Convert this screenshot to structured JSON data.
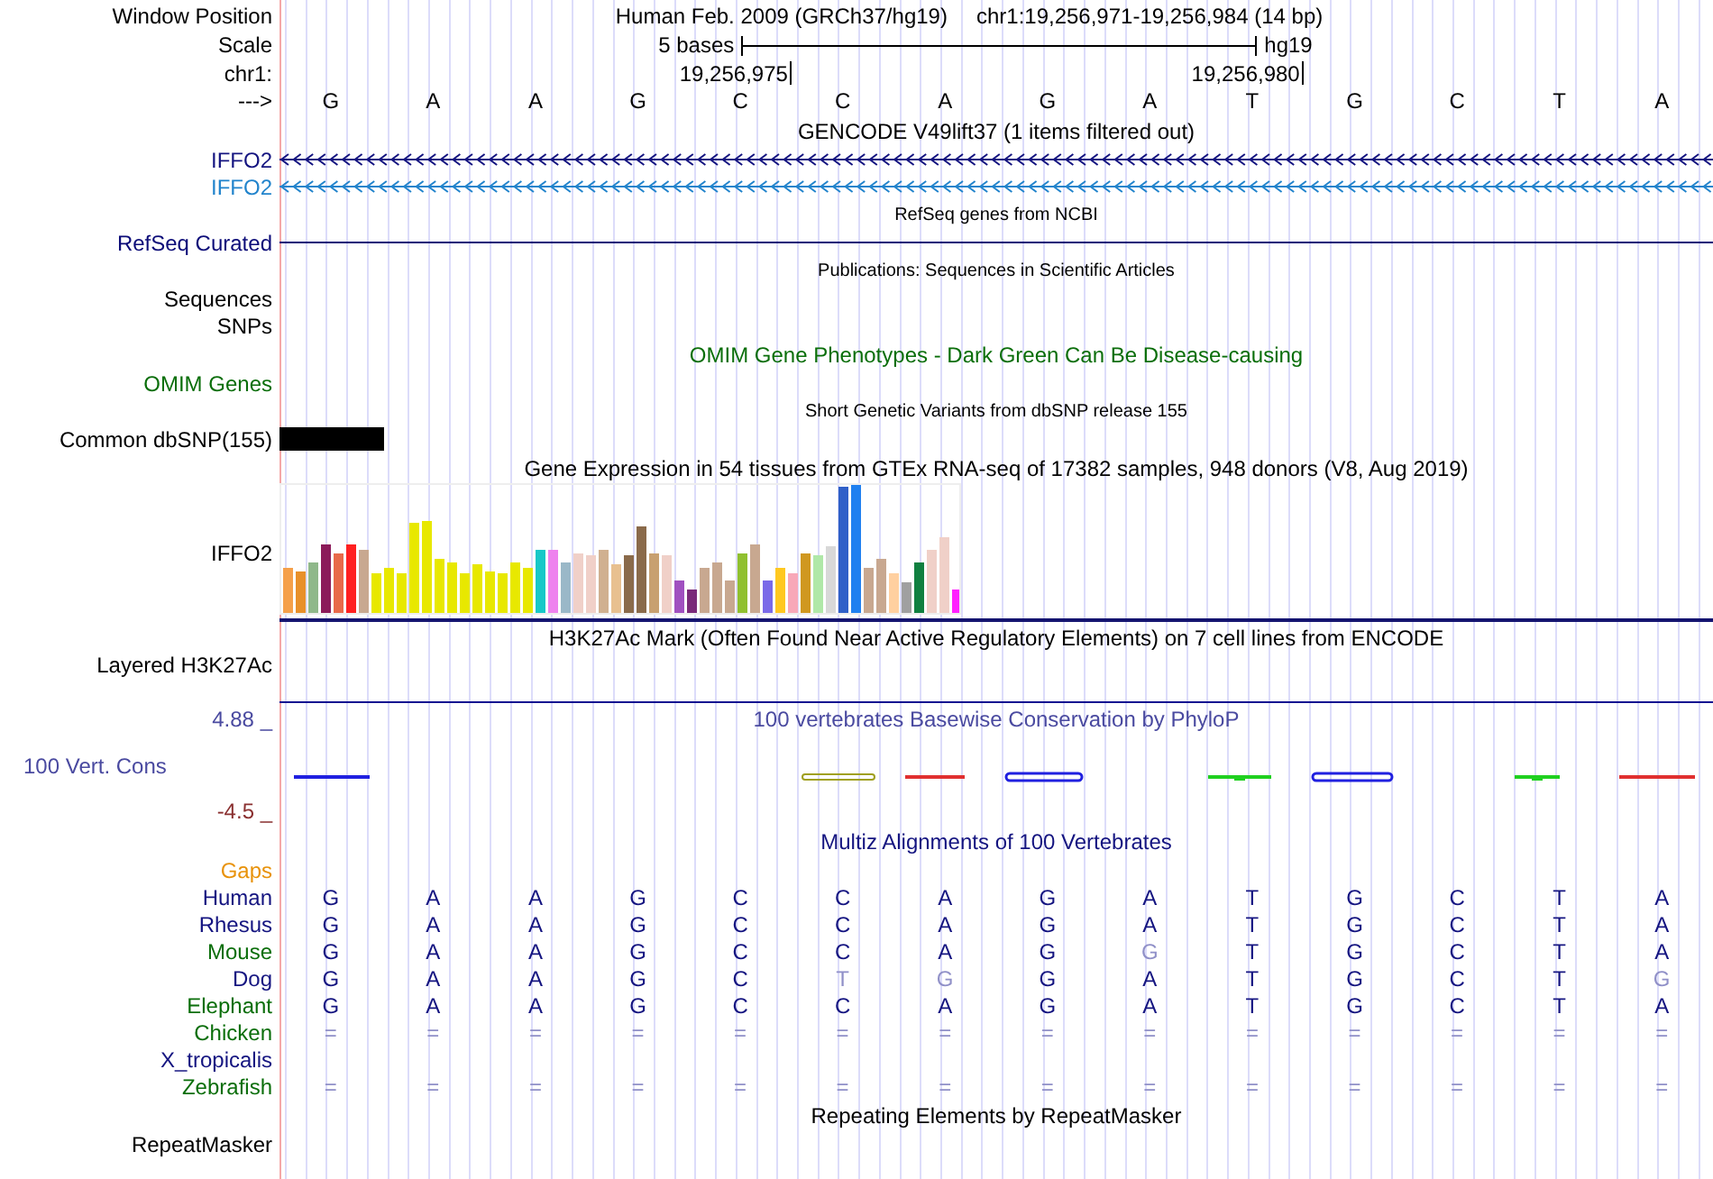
{
  "rows": [
    {
      "kind": "position",
      "label": "Window Position",
      "assembly": "Human Feb. 2009 (GRCh37/hg19)",
      "range": "chr1:19,256,971-19,256,984 (14 bp)"
    },
    {
      "kind": "scale",
      "label": "Scale",
      "length": "5 bases",
      "assembly": "hg19"
    },
    {
      "kind": "ruler",
      "label": "chr1:",
      "ticks": [
        "19,256,975",
        "19,256,980"
      ]
    },
    {
      "kind": "bases",
      "label": "--->",
      "bases": [
        "G",
        "A",
        "A",
        "G",
        "C",
        "C",
        "A",
        "G",
        "A",
        "T",
        "G",
        "C",
        "T",
        "A"
      ]
    },
    {
      "kind": "title",
      "text": "GENCODE V49lift37 (1 items filtered out)"
    },
    {
      "kind": "gene",
      "label": "IFFO2",
      "color": "#141480"
    },
    {
      "kind": "gene",
      "label": "IFFO2",
      "color": "#2284cc"
    },
    {
      "kind": "subtitle",
      "text": "RefSeq genes from NCBI"
    },
    {
      "kind": "line",
      "label": "RefSeq Curated",
      "color": "#0c0c78"
    },
    {
      "kind": "subtitle",
      "text": "Publications: Sequences in Scientific Articles"
    },
    {
      "kind": "label",
      "label": "Sequences"
    },
    {
      "kind": "label",
      "label": "SNPs"
    },
    {
      "kind": "title",
      "text": "OMIM Gene Phenotypes - Dark Green Can Be Disease-causing",
      "color": "#0a6e0a"
    },
    {
      "kind": "label",
      "label": "OMIM Genes",
      "color": "#0a6e0a"
    },
    {
      "kind": "subtitle",
      "text": "Short Genetic Variants from dbSNP release 155"
    },
    {
      "kind": "variant",
      "label": "Common dbSNP(155)"
    },
    {
      "kind": "title",
      "text": "Gene Expression in 54 tissues from GTEx RNA-seq of 17382 samples, 948 donors (V8, Aug 2019)"
    },
    {
      "kind": "expression",
      "label": "IFFO2"
    },
    {
      "kind": "title",
      "text": "H3K27Ac Mark (Often Found Near Active Regulatory Elements) on 7 cell lines from ENCODE"
    },
    {
      "kind": "signal",
      "label": "Layered H3K27Ac"
    },
    {
      "kind": "conservation",
      "title": "100 vertebrates Basewise Conservation by PhyloP",
      "label": "100 Vert. Cons",
      "max": "4.88 _",
      "min": "-4.5 _"
    },
    {
      "kind": "title",
      "text": "Multiz Alignments of 100 Vertebrates",
      "color": "#141480"
    },
    {
      "kind": "label",
      "label": "Gaps",
      "color": "#e8920a"
    },
    {
      "kind": "alignment",
      "label": "Human",
      "color": "#141480",
      "bases": [
        {
          "base": "G",
          "faded": false
        },
        {
          "base": "A",
          "faded": false
        },
        {
          "base": "A",
          "faded": false
        },
        {
          "base": "G",
          "faded": false
        },
        {
          "base": "C",
          "faded": false
        },
        {
          "base": "C",
          "faded": false
        },
        {
          "base": "A",
          "faded": false
        },
        {
          "base": "G",
          "faded": false
        },
        {
          "base": "A",
          "faded": false
        },
        {
          "base": "T",
          "faded": false
        },
        {
          "base": "G",
          "faded": false
        },
        {
          "base": "C",
          "faded": false
        },
        {
          "base": "T",
          "faded": false
        },
        {
          "base": "A",
          "faded": false
        }
      ]
    },
    {
      "kind": "alignment",
      "label": "Rhesus",
      "color": "#141480",
      "bases": [
        {
          "base": "G",
          "faded": false
        },
        {
          "base": "A",
          "faded": false
        },
        {
          "base": "A",
          "faded": false
        },
        {
          "base": "G",
          "faded": false
        },
        {
          "base": "C",
          "faded": false
        },
        {
          "base": "C",
          "faded": false
        },
        {
          "base": "A",
          "faded": false
        },
        {
          "base": "G",
          "faded": false
        },
        {
          "base": "A",
          "faded": false
        },
        {
          "base": "T",
          "faded": false
        },
        {
          "base": "G",
          "faded": false
        },
        {
          "base": "C",
          "faded": false
        },
        {
          "base": "T",
          "faded": false
        },
        {
          "base": "A",
          "faded": false
        }
      ]
    },
    {
      "kind": "alignment",
      "label": "Mouse",
      "color": "#0a6e0a",
      "bases": [
        {
          "base": "G",
          "faded": false
        },
        {
          "base": "A",
          "faded": false
        },
        {
          "base": "A",
          "faded": false
        },
        {
          "base": "G",
          "faded": false
        },
        {
          "base": "C",
          "faded": false
        },
        {
          "base": "C",
          "faded": false
        },
        {
          "base": "A",
          "faded": false
        },
        {
          "base": "G",
          "faded": false
        },
        {
          "base": "G",
          "faded": true
        },
        {
          "base": "T",
          "faded": false
        },
        {
          "base": "G",
          "faded": false
        },
        {
          "base": "C",
          "faded": false
        },
        {
          "base": "T",
          "faded": false
        },
        {
          "base": "A",
          "faded": false
        }
      ]
    },
    {
      "kind": "alignment",
      "label": "Dog",
      "color": "#141480",
      "bases": [
        {
          "base": "G",
          "faded": false
        },
        {
          "base": "A",
          "faded": false
        },
        {
          "base": "A",
          "faded": false
        },
        {
          "base": "G",
          "faded": false
        },
        {
          "base": "C",
          "faded": false
        },
        {
          "base": "T",
          "faded": true
        },
        {
          "base": "G",
          "faded": true
        },
        {
          "base": "G",
          "faded": false
        },
        {
          "base": "A",
          "faded": false
        },
        {
          "base": "T",
          "faded": false
        },
        {
          "base": "G",
          "faded": false
        },
        {
          "base": "C",
          "faded": false
        },
        {
          "base": "T",
          "faded": false
        },
        {
          "base": "G",
          "faded": true
        }
      ]
    },
    {
      "kind": "alignment",
      "label": "Elephant",
      "color": "#0a6e0a",
      "bases": [
        {
          "base": "G",
          "faded": false
        },
        {
          "base": "A",
          "faded": false
        },
        {
          "base": "A",
          "faded": false
        },
        {
          "base": "G",
          "faded": false
        },
        {
          "base": "C",
          "faded": false
        },
        {
          "base": "C",
          "faded": false
        },
        {
          "base": "A",
          "faded": false
        },
        {
          "base": "G",
          "faded": false
        },
        {
          "base": "A",
          "faded": false
        },
        {
          "base": "T",
          "faded": false
        },
        {
          "base": "G",
          "faded": false
        },
        {
          "base": "C",
          "faded": false
        },
        {
          "base": "T",
          "faded": false
        },
        {
          "base": "A",
          "faded": false
        }
      ]
    },
    {
      "kind": "alignment",
      "label": "Chicken",
      "color": "#0a6e0a",
      "bases": [
        {
          "base": "=",
          "faded": true
        },
        {
          "base": "=",
          "faded": true
        },
        {
          "base": "=",
          "faded": true
        },
        {
          "base": "=",
          "faded": true
        },
        {
          "base": "=",
          "faded": true
        },
        {
          "base": "=",
          "faded": true
        },
        {
          "base": "=",
          "faded": true
        },
        {
          "base": "=",
          "faded": true
        },
        {
          "base": "=",
          "faded": true
        },
        {
          "base": "=",
          "faded": true
        },
        {
          "base": "=",
          "faded": true
        },
        {
          "base": "=",
          "faded": true
        },
        {
          "base": "=",
          "faded": true
        },
        {
          "base": "=",
          "faded": true
        }
      ]
    },
    {
      "kind": "label",
      "label": "X_tropicalis",
      "color": "#141480"
    },
    {
      "kind": "alignment",
      "label": "Zebrafish",
      "color": "#0a6e0a",
      "bases": [
        {
          "base": "=",
          "faded": true
        },
        {
          "base": "=",
          "faded": true
        },
        {
          "base": "=",
          "faded": true
        },
        {
          "base": "=",
          "faded": true
        },
        {
          "base": "=",
          "faded": true
        },
        {
          "base": "=",
          "faded": true
        },
        {
          "base": "=",
          "faded": true
        },
        {
          "base": "=",
          "faded": true
        },
        {
          "base": "=",
          "faded": true
        },
        {
          "base": "=",
          "faded": true
        },
        {
          "base": "=",
          "faded": true
        },
        {
          "base": "=",
          "faded": true
        },
        {
          "base": "=",
          "faded": true
        },
        {
          "base": "=",
          "faded": true
        }
      ]
    },
    {
      "kind": "title",
      "text": "Repeating Elements by RepeatMasker"
    },
    {
      "kind": "label",
      "label": "RepeatMasker"
    }
  ]
}
